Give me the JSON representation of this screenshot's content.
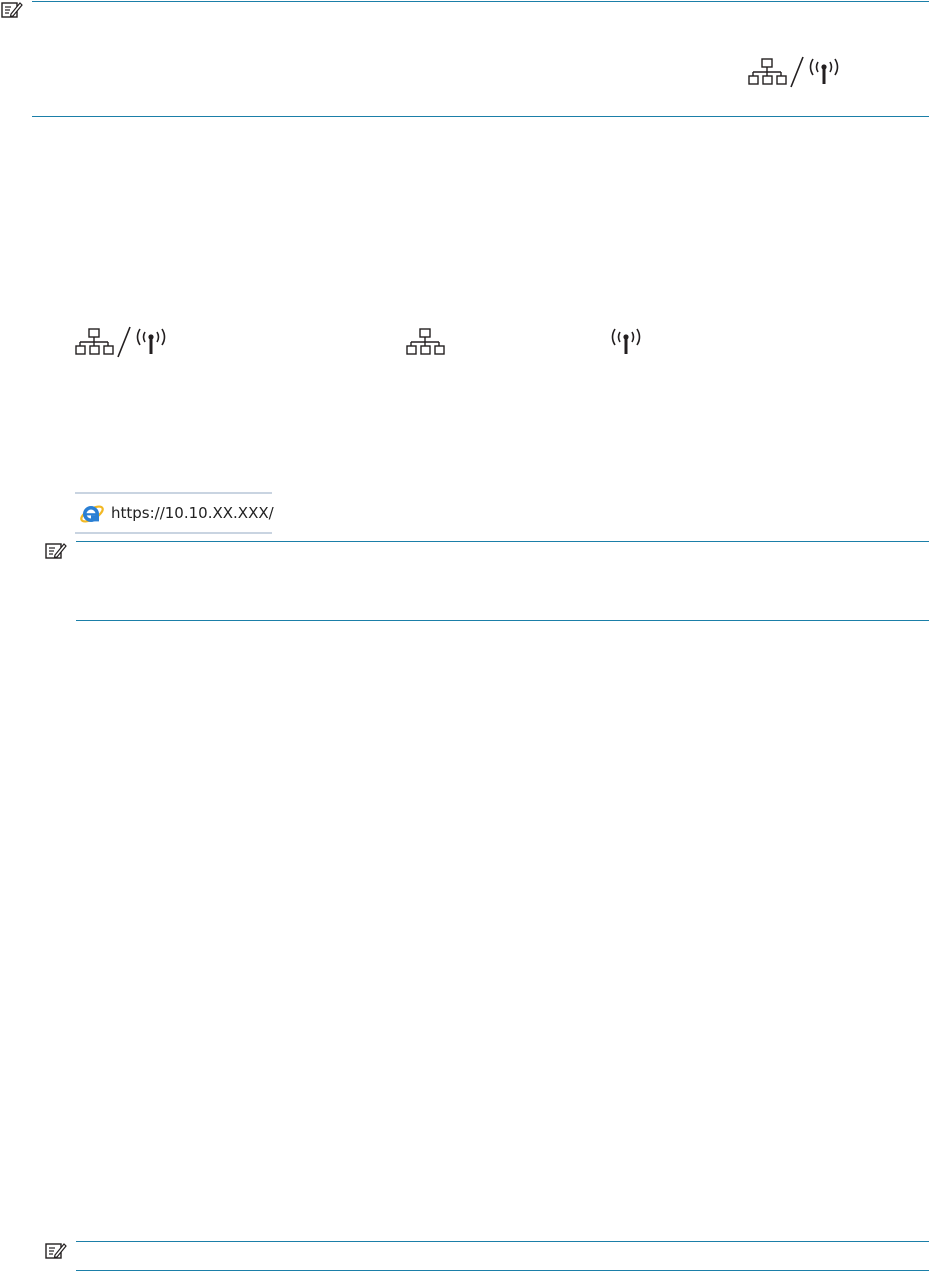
{
  "page": {
    "notes": [
      {
        "icon": "note-icon"
      },
      {
        "icon": "note-icon"
      },
      {
        "icon": "note-icon"
      }
    ],
    "icons": {
      "network": "network-icon",
      "wireless": "wireless-icon",
      "separator": "slash-icon"
    },
    "address_bar": {
      "browser_icon": "internet-explorer-icon",
      "url": "https://10.10.XX.XXX/"
    },
    "colors": {
      "rule": "#1b7fa8",
      "icon": "#231f20"
    }
  }
}
